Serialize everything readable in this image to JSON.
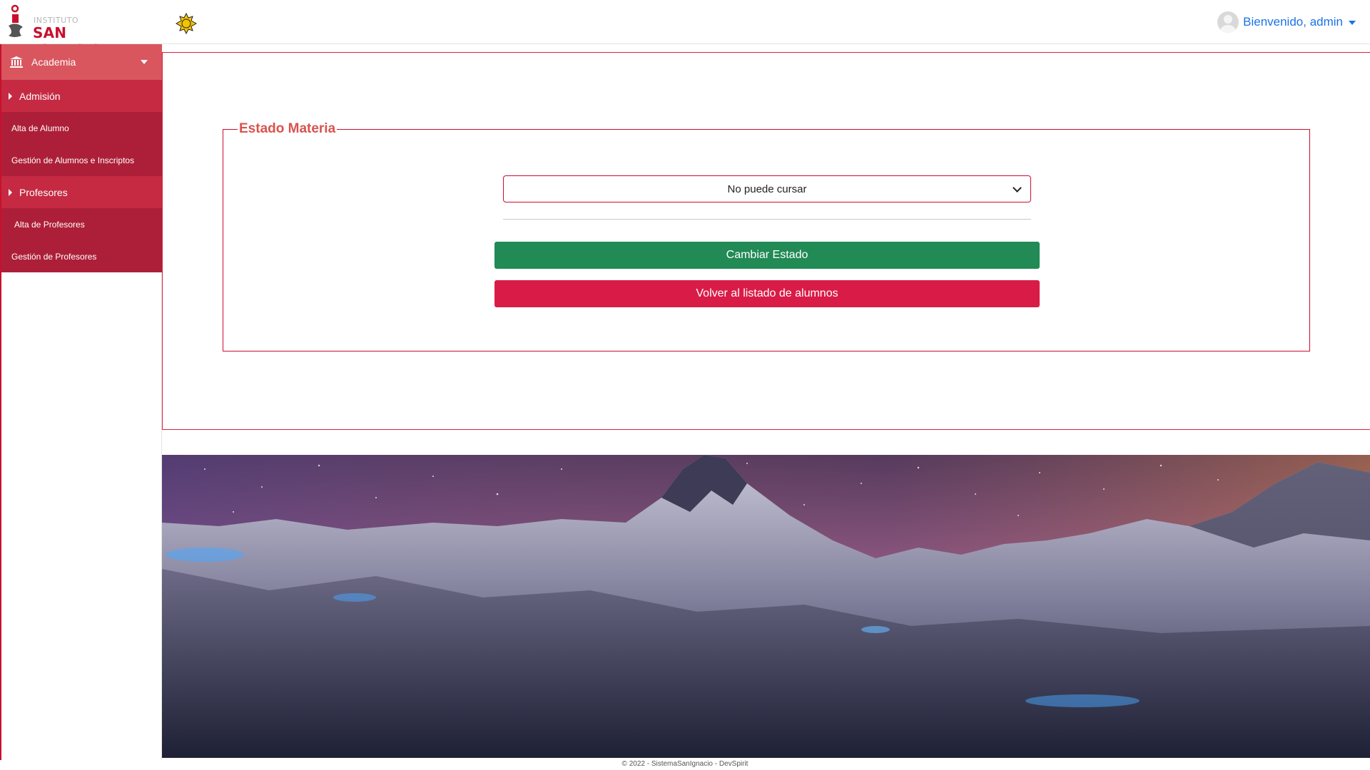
{
  "brand": {
    "small": "INSTITUTO",
    "big": "SAN IGNACIO"
  },
  "header": {
    "user_greeting": "Bienvenido, admin"
  },
  "sidebar": {
    "top": {
      "label": "Academia",
      "icon": "bank-icon"
    },
    "sections": [
      {
        "label": "Admisión",
        "items": [
          "Alta de Alumno",
          "Gestión de Alumnos e Inscriptos"
        ]
      },
      {
        "label": "Profesores",
        "items": [
          "Alta de Profesores",
          "Gestión de Profesores"
        ]
      }
    ]
  },
  "form": {
    "legend": "Estado Materia",
    "select_value": "No puede cursar",
    "submit_label": "Cambiar Estado",
    "back_label": "Volver al listado de alumnos"
  },
  "footer": {
    "text": "© 2022 - SistemaSanIgnacio - DevSpirit"
  },
  "colors": {
    "brand_red": "#c8102e",
    "green": "#218a55",
    "button_red": "#d91c47",
    "link_blue": "#1a73e8"
  }
}
